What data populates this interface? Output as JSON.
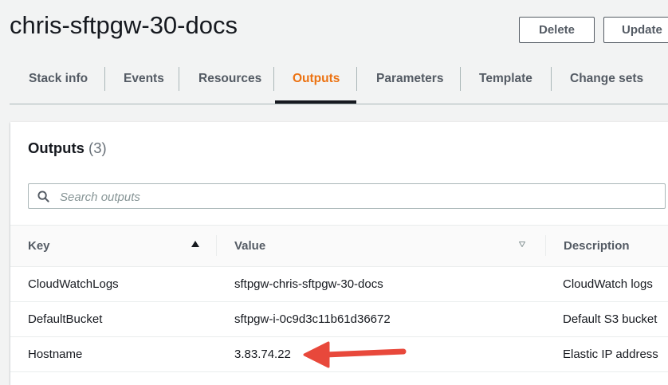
{
  "header": {
    "stack_name": "chris-sftpgw-30-docs",
    "delete_label": "Delete",
    "update_label": "Update"
  },
  "tabs": [
    {
      "label": "Stack info",
      "active": false
    },
    {
      "label": "Events",
      "active": false
    },
    {
      "label": "Resources",
      "active": false
    },
    {
      "label": "Outputs",
      "active": true
    },
    {
      "label": "Parameters",
      "active": false
    },
    {
      "label": "Template",
      "active": false
    },
    {
      "label": "Change sets",
      "active": false
    }
  ],
  "outputs": {
    "title": "Outputs",
    "count": "(3)",
    "search_placeholder": "Search outputs",
    "columns": {
      "key": "Key",
      "value": "Value",
      "description": "Description"
    },
    "rows": [
      {
        "key": "CloudWatchLogs",
        "value": "sftpgw-chris-sftpgw-30-docs",
        "description": "CloudWatch logs"
      },
      {
        "key": "DefaultBucket",
        "value": "sftpgw-i-0c9d3c11b61d36672",
        "description": "Default S3 bucket"
      },
      {
        "key": "Hostname",
        "value": "3.83.74.22",
        "description": "Elastic IP address"
      }
    ]
  },
  "colors": {
    "accent": "#ec7211",
    "annotation_arrow": "#e8483b",
    "background": "#f2f3f3"
  },
  "icons": {
    "search": "search-icon",
    "sort_ascending": "sort-ascending-icon",
    "sort_descending": "sort-descending-icon",
    "annotation": "red-arrow-annotation"
  }
}
